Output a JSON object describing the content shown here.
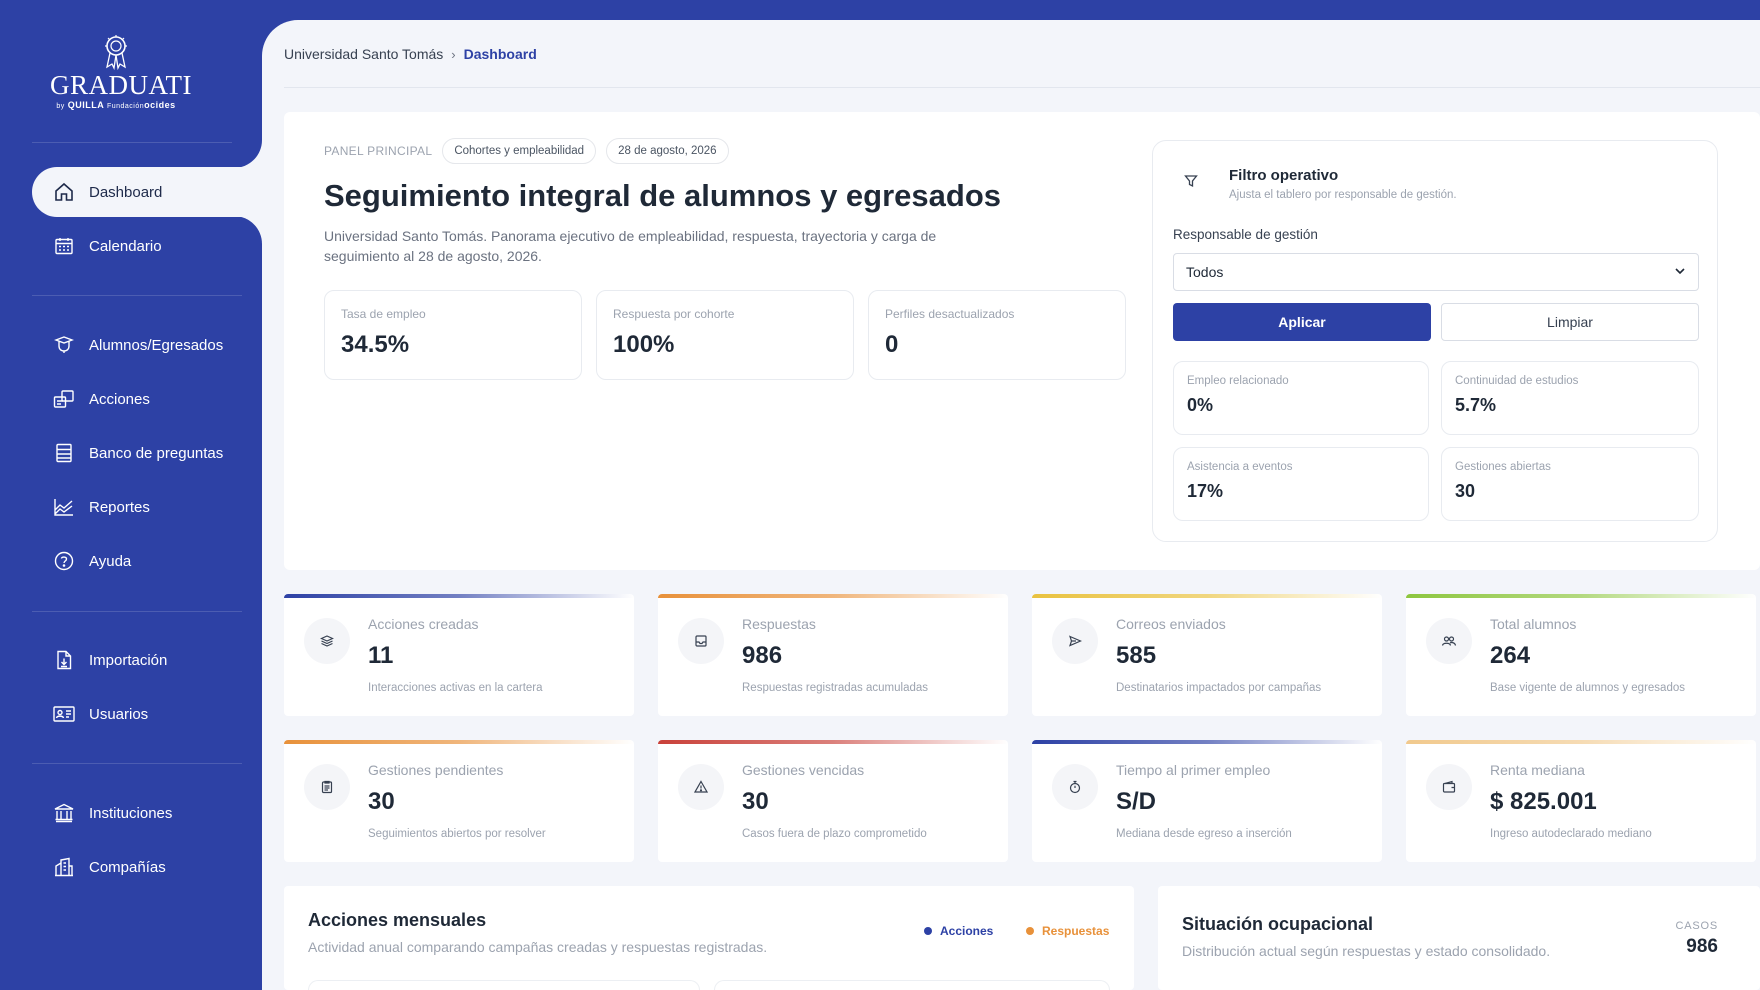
{
  "brand": {
    "name": "GRADUATI",
    "by": "by",
    "partner1": "QUILLA",
    "partner2_top": "Fundación",
    "partner2": "ocides"
  },
  "sidebar": {
    "items": [
      {
        "label": "Dashboard",
        "icon": "home-icon"
      },
      {
        "label": "Calendario",
        "icon": "calendar-icon"
      },
      {
        "label": "Alumnos/Egresados",
        "icon": "graduate-icon"
      },
      {
        "label": "Acciones",
        "icon": "actions-icon"
      },
      {
        "label": "Banco de preguntas",
        "icon": "question-bank-icon"
      },
      {
        "label": "Reportes",
        "icon": "reports-icon"
      },
      {
        "label": "Ayuda",
        "icon": "help-icon"
      },
      {
        "label": "Importación",
        "icon": "import-icon"
      },
      {
        "label": "Usuarios",
        "icon": "users-icon"
      },
      {
        "label": "Instituciones",
        "icon": "institution-icon"
      },
      {
        "label": "Compañías",
        "icon": "company-icon"
      }
    ]
  },
  "breadcrumb": {
    "root": "Universidad Santo Tomás",
    "current": "Dashboard"
  },
  "panel": {
    "eyebrow": "PANEL PRINCIPAL",
    "chip1": "Cohortes y empleabilidad",
    "chip2": "28 de agosto, 2026",
    "title": "Seguimiento integral de alumnos y egresados",
    "description": "Universidad Santo Tomás. Panorama ejecutivo de empleabilidad, respuesta, trayectoria y carga de seguimiento al 28 de agosto, 2026.",
    "kpis": [
      {
        "label": "Tasa de empleo",
        "value": "34.5%"
      },
      {
        "label": "Respuesta por cohorte",
        "value": "100%"
      },
      {
        "label": "Perfiles desactualizados",
        "value": "0"
      }
    ]
  },
  "filter": {
    "title": "Filtro operativo",
    "subtitle": "Ajusta el tablero por responsable de gestión.",
    "field_label": "Responsable de gestión",
    "selected": "Todos",
    "apply": "Aplicar",
    "clear": "Limpiar",
    "metrics": [
      {
        "label": "Empleo relacionado",
        "value": "0%"
      },
      {
        "label": "Continuidad de estudios",
        "value": "5.7%"
      },
      {
        "label": "Asistencia a eventos",
        "value": "17%"
      },
      {
        "label": "Gestiones abiertas",
        "value": "30"
      }
    ]
  },
  "stats": [
    {
      "label": "Acciones creadas",
      "value": "11",
      "sub": "Interacciones activas en la cartera",
      "icon": "layers-icon",
      "accent": "#2d41a5"
    },
    {
      "label": "Respuestas",
      "value": "986",
      "sub": "Respuestas registradas acumuladas",
      "icon": "inbox-icon",
      "accent": "#e8913a"
    },
    {
      "label": "Correos enviados",
      "value": "585",
      "sub": "Destinatarios impactados por campañas",
      "icon": "send-icon",
      "accent": "#e9c23f"
    },
    {
      "label": "Total alumnos",
      "value": "264",
      "sub": "Base vigente de alumnos y egresados",
      "icon": "people-icon",
      "accent": "#8dc63f"
    },
    {
      "label": "Gestiones pendientes",
      "value": "30",
      "sub": "Seguimientos abiertos por resolver",
      "icon": "clipboard-icon",
      "accent": "#e8913a"
    },
    {
      "label": "Gestiones vencidas",
      "value": "30",
      "sub": "Casos fuera de plazo comprometido",
      "icon": "warning-icon",
      "accent": "#c9413a"
    },
    {
      "label": "Tiempo al primer empleo",
      "value": "S/D",
      "sub": "Mediana desde egreso a inserción",
      "icon": "timer-icon",
      "accent": "#2d41a5"
    },
    {
      "label": "Renta mediana",
      "value": "$ 825.001",
      "sub": "Ingreso autodeclarado mediano",
      "icon": "wallet-icon",
      "accent": "#f1c98d"
    }
  ],
  "monthly": {
    "title": "Acciones mensuales",
    "subtitle": "Actividad anual comparando campañas creadas y respuestas registradas.",
    "legend": [
      {
        "label": "Acciones",
        "color": "#2d41a5"
      },
      {
        "label": "Respuestas",
        "color": "#e8913a"
      }
    ]
  },
  "occupational": {
    "title": "Situación ocupacional",
    "subtitle": "Distribución actual según respuestas y estado consolidado.",
    "cases_label": "CASOS",
    "cases_value": "986"
  }
}
